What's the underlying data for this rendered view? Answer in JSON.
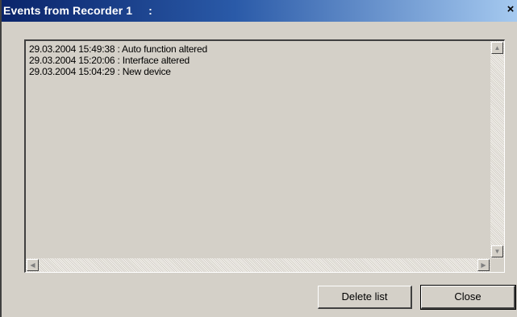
{
  "window": {
    "title": "Events from Recorder 1     :",
    "close_glyph": "×"
  },
  "events": [
    "29.03.2004 15:49:38 : Auto function altered",
    "29.03.2004 15:20:06 : Interface altered",
    "29.03.2004 15:04:29 : New device"
  ],
  "scrollbar": {
    "up_glyph": "▲",
    "down_glyph": "▼",
    "left_glyph": "◀",
    "right_glyph": "▶"
  },
  "buttons": {
    "delete_label": "Delete list",
    "close_label": "Close"
  },
  "colors": {
    "title_gradient_start": "#0a246a",
    "title_gradient_end": "#a6caf0",
    "face": "#d4d0c8"
  }
}
